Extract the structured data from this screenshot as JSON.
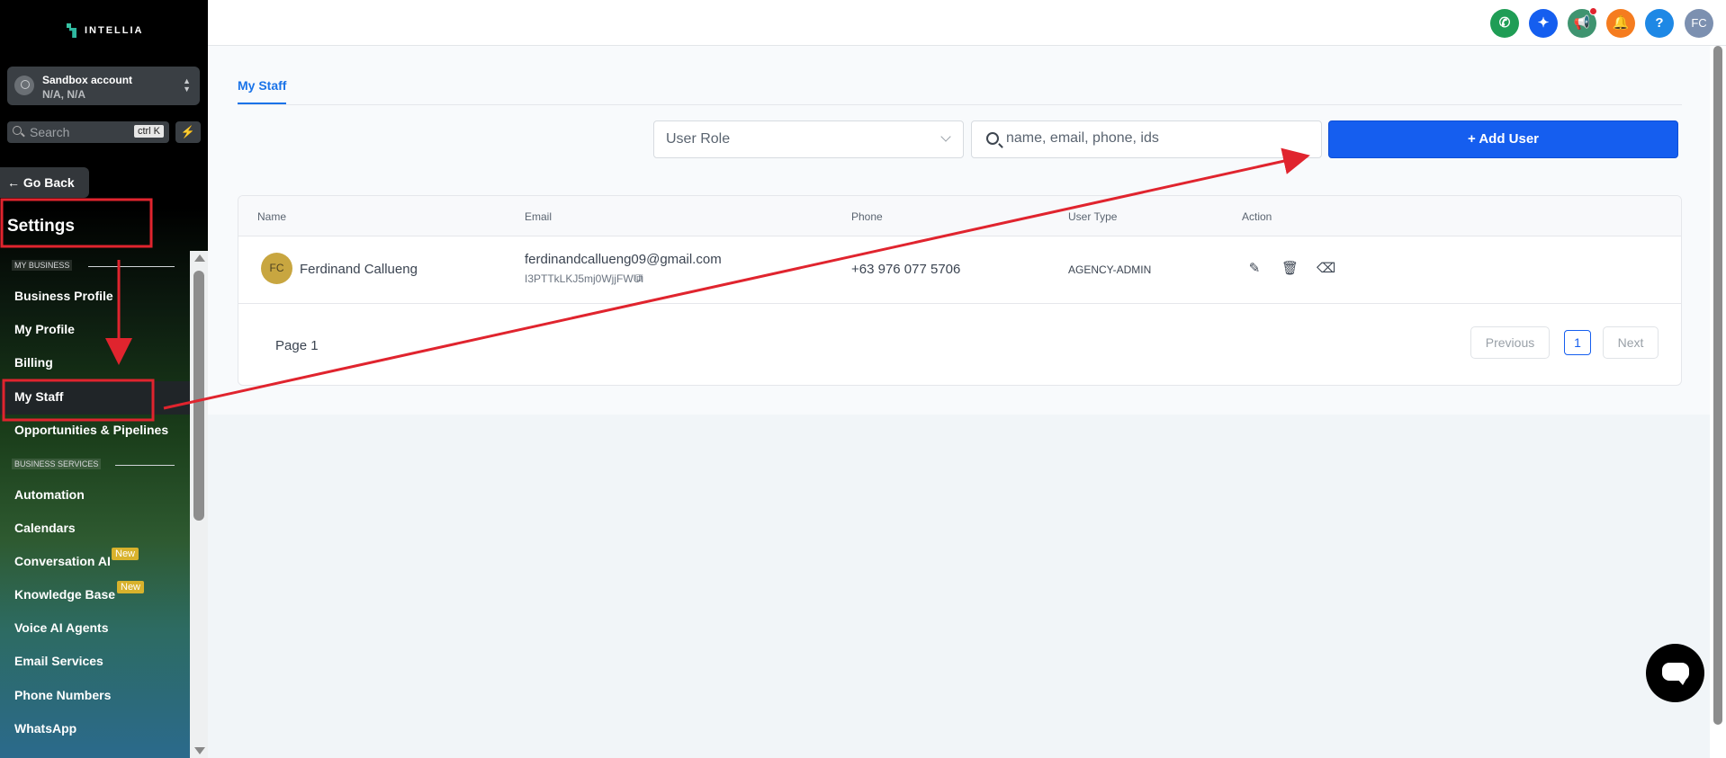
{
  "sidebar": {
    "logo_text": "INTELLIA",
    "account": {
      "name": "Sandbox account",
      "location": "N/A, N/A"
    },
    "search": {
      "placeholder": "Search",
      "shortcut": "ctrl K"
    },
    "go_back_label": "Go Back",
    "title": "Settings",
    "sections": [
      {
        "label": "MY BUSINESS",
        "items": [
          "Business Profile",
          "My Profile",
          "Billing",
          "My Staff",
          "Opportunities & Pipelines"
        ]
      },
      {
        "label": "BUSINESS SERVICES",
        "items": [
          "Automation",
          "Calendars",
          "Conversation AI",
          "Knowledge Base",
          "Voice AI Agents",
          "Email Services",
          "Phone Numbers",
          "WhatsApp"
        ]
      }
    ],
    "active_item": "My Staff",
    "new_badge": "New"
  },
  "topbar": {
    "icons": [
      "phone-icon",
      "sparkle-icon",
      "megaphone-icon",
      "bell-icon",
      "help-icon"
    ],
    "help_label": "?",
    "user_initials": "FC"
  },
  "main": {
    "tab_label": "My Staff",
    "role_select": {
      "value": "User Role"
    },
    "search": {
      "placeholder": "name, email, phone, ids"
    },
    "add_user_label": "+ Add User",
    "table": {
      "columns": [
        "Name",
        "Email",
        "Phone",
        "User Type",
        "Action"
      ],
      "rows": [
        {
          "initials": "FC",
          "name": "Ferdinand Callueng",
          "email": "ferdinandcallueng09@gmail.com",
          "id": "I3PTTkLKJ5mj0WjjFWUi",
          "phone": "+63 976 077 5706",
          "user_type": "AGENCY-ADMIN"
        }
      ]
    },
    "pagination": {
      "label": "Page 1",
      "previous": "Previous",
      "current": "1",
      "next": "Next"
    }
  },
  "colors": {
    "primary": "#155eef",
    "annotation": "#e0242e",
    "avatar": "#c8a640"
  }
}
